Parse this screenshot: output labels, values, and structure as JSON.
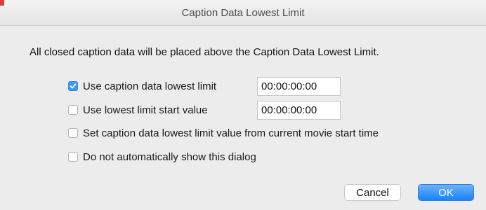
{
  "dialog": {
    "title": "Caption Data Lowest Limit",
    "message": "All closed caption data will be placed above the Caption Data Lowest Limit."
  },
  "options": [
    {
      "label": "Use caption data lowest limit",
      "checked": true,
      "value": "00:00:00:00"
    },
    {
      "label": "Use lowest limit start value",
      "checked": false,
      "value": "00:00:00:00"
    },
    {
      "label": "Set caption data lowest limit value from current movie start time",
      "checked": false
    },
    {
      "label": "Do not automatically show this dialog",
      "checked": false
    }
  ],
  "buttons": {
    "cancel_label": "Cancel",
    "ok_label": "OK"
  },
  "colors": {
    "accent": "#3b99fc",
    "window_bg": "#ececec"
  }
}
